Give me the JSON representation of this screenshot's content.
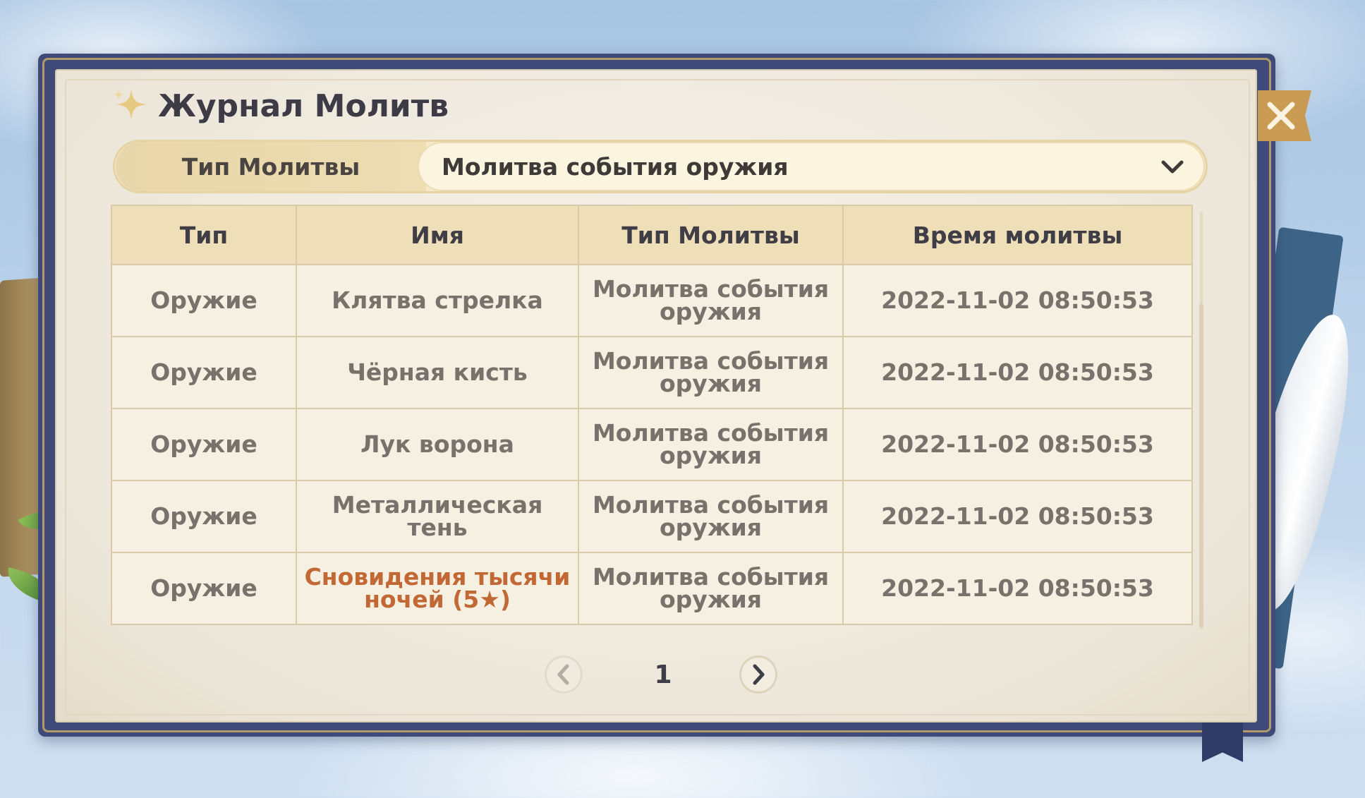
{
  "window": {
    "title": "Журнал Молитв"
  },
  "filter": {
    "label": "Тип Молитвы",
    "selected_value": "Молитва события оружия"
  },
  "table": {
    "headers": [
      "Тип",
      "Имя",
      "Тип Молитвы",
      "Время молитвы"
    ],
    "rows": [
      {
        "type": "Оружие",
        "name": "Клятва стрелка",
        "wish_type": "Молитва события оружия",
        "time": "2022-11-02 08:50:53"
      },
      {
        "type": "Оружие",
        "name": "Чёрная кисть",
        "wish_type": "Молитва события оружия",
        "time": "2022-11-02 08:50:53"
      },
      {
        "type": "Оружие",
        "name": "Лук ворона",
        "wish_type": "Молитва события оружия",
        "time": "2022-11-02 08:50:53"
      },
      {
        "type": "Оружие",
        "name": "Металлическая тень",
        "wish_type": "Молитва события оружия",
        "time": "2022-11-02 08:50:53"
      },
      {
        "type": "Оружие",
        "name": "Сновидения тысячи ночей (5★)",
        "wish_type": "Молитва события оружия",
        "time": "2022-11-02 08:50:53"
      }
    ]
  },
  "pagination": {
    "current_page": "1"
  },
  "icons": {
    "title": "sparkle-icon",
    "close": "close-icon",
    "dropdown": "chevron-down-icon",
    "prev": "chevron-left-icon",
    "next": "chevron-right-icon"
  },
  "colors": {
    "rare_item": "#c26835",
    "header_bg": "#efdfb9",
    "close_button": "#c89a52"
  }
}
